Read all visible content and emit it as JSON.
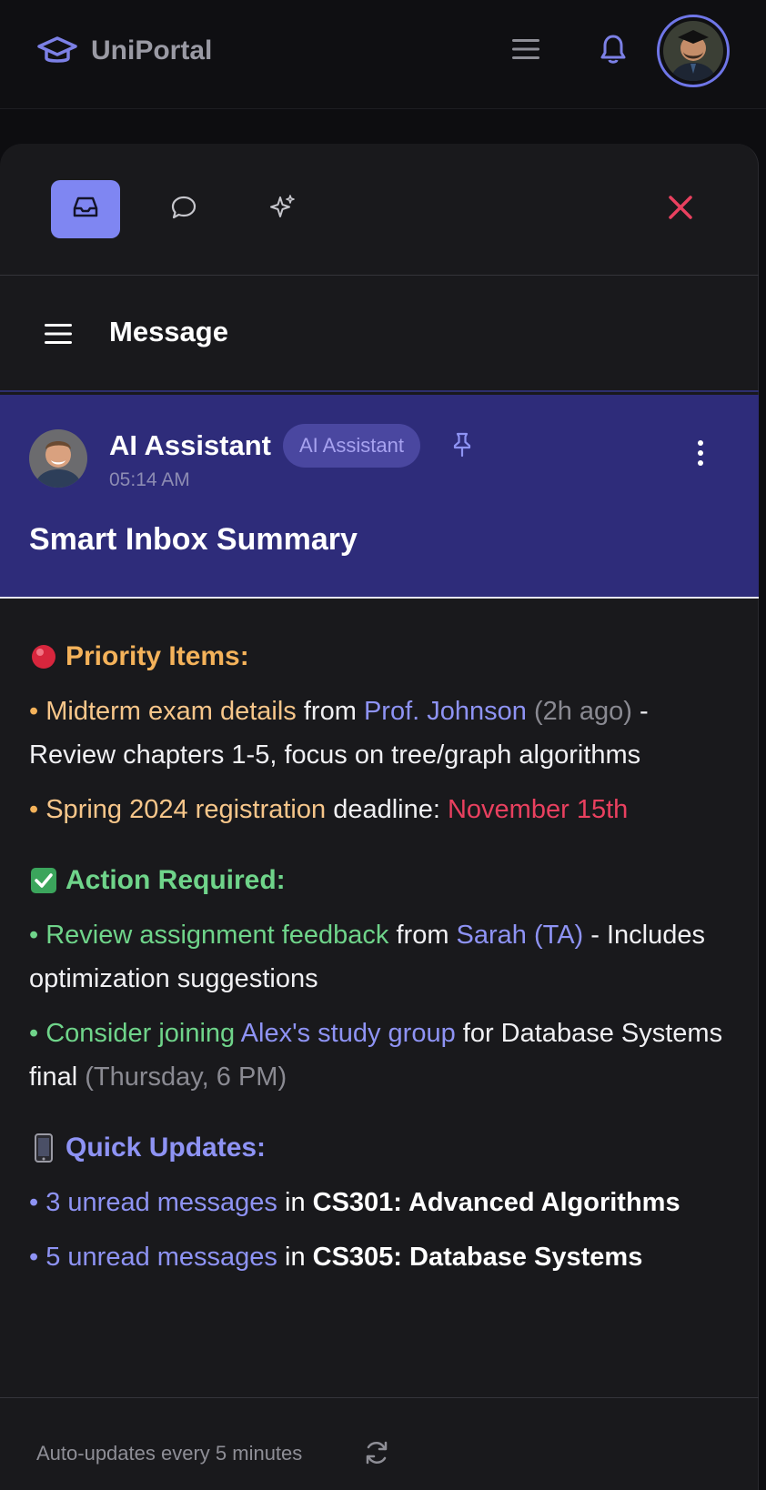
{
  "app": {
    "name": "UniPortal"
  },
  "tabs": [
    {
      "id": "inbox",
      "icon": "inbox-icon",
      "active": true
    },
    {
      "id": "chat",
      "icon": "chat-bubble-icon",
      "active": false
    },
    {
      "id": "ai",
      "icon": "sparkle-icon",
      "active": false
    }
  ],
  "header": {
    "title": "Message"
  },
  "message": {
    "sender": "AI Assistant",
    "badge": "AI Assistant",
    "time": "05:14 AM",
    "subject": "Smart Inbox Summary"
  },
  "sections": {
    "priority": {
      "emoji": "🔴",
      "title": "Priority Items:",
      "item1": {
        "bullet": "•",
        "highlight": "Midterm exam details",
        "from": "from",
        "person": "Prof. Johnson",
        "ago": "(2h ago)",
        "detail": "- Review chapters 1-5, focus on tree/graph algorithms"
      },
      "item2": {
        "bullet": "•",
        "highlight": "Spring 2024 registration",
        "text": "deadline:",
        "date": "November 15th"
      }
    },
    "action": {
      "emoji": "✅",
      "title": "Action Required:",
      "item1": {
        "bullet": "•",
        "highlight": "Review assignment feedback",
        "from": "from",
        "person": "Sarah (TA)",
        "detail": "- Includes optimization suggestions"
      },
      "item2": {
        "bullet": "•",
        "highlight": "Consider joining",
        "group": "Alex's study group",
        "text": "for Database Systems final",
        "when": "(Thursday, 6 PM)"
      }
    },
    "updates": {
      "emoji": "📱",
      "title": "Quick Updates:",
      "item1": {
        "bullet": "•",
        "count": "3 unread messages",
        "text": "in",
        "course": "CS301: Advanced Algorithms"
      },
      "item2": {
        "bullet": "•",
        "count": "5 unread messages",
        "text": "in",
        "course": "CS305: Database Systems"
      }
    }
  },
  "footer": {
    "text": "Auto-updates every 5 minutes"
  },
  "colors": {
    "accent": "#7f86f2",
    "highlight_bg": "#2e2c7a",
    "close": "#e9405f"
  }
}
